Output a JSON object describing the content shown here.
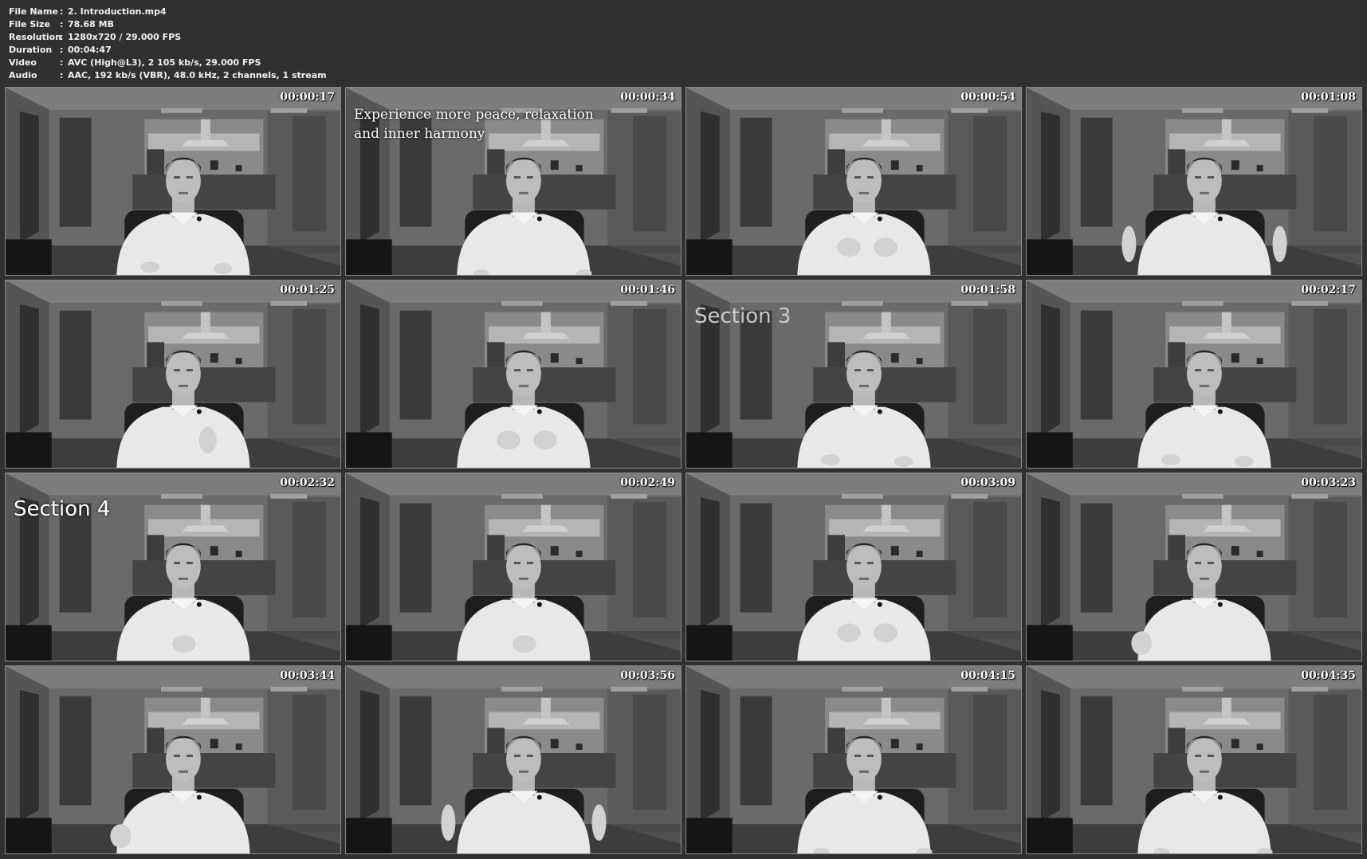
{
  "file_info": [
    {
      "label": "File Name",
      "value": "2. Introduction.mp4"
    },
    {
      "label": "File Size",
      "value": "78.68 MB"
    },
    {
      "label": "Resolution",
      "value": "1280x720 / 29.000 FPS"
    },
    {
      "label": "Duration",
      "value": "00:04:47"
    },
    {
      "label": "Video",
      "value": "AVC (High@L3), 2 105 kb/s, 29.000 FPS"
    },
    {
      "label": "Audio",
      "value": "AAC, 192 kb/s (VBR), 48.0 kHz, 2 channels, 1 stream"
    }
  ],
  "separator": ":",
  "thumbnails": [
    {
      "timestamp": "00:00:17",
      "caption": "",
      "gesture": "hands-low"
    },
    {
      "timestamp": "00:00:34",
      "caption": "Experience more peace, relaxation and inner harmony",
      "gesture": "hands-down"
    },
    {
      "timestamp": "00:00:54",
      "caption": "",
      "gesture": "hands-chest"
    },
    {
      "timestamp": "00:01:08",
      "caption": "",
      "gesture": "hands-wide"
    },
    {
      "timestamp": "00:01:25",
      "caption": "",
      "gesture": "hand-right"
    },
    {
      "timestamp": "00:01:46",
      "caption": "",
      "gesture": "hands-chest"
    },
    {
      "timestamp": "00:01:58",
      "caption": "Section 3",
      "gesture": "hands-low"
    },
    {
      "timestamp": "00:02:17",
      "caption": "",
      "gesture": "hands-low"
    },
    {
      "timestamp": "00:02:32",
      "caption": "Section 4",
      "gesture": "hands-center"
    },
    {
      "timestamp": "00:02:49",
      "caption": "",
      "gesture": "hands-center"
    },
    {
      "timestamp": "00:03:09",
      "caption": "",
      "gesture": "hands-chest"
    },
    {
      "timestamp": "00:03:23",
      "caption": "",
      "gesture": "hand-left"
    },
    {
      "timestamp": "00:03:44",
      "caption": "",
      "gesture": "hand-left"
    },
    {
      "timestamp": "00:03:56",
      "caption": "",
      "gesture": "hands-wide"
    },
    {
      "timestamp": "00:04:15",
      "caption": "",
      "gesture": "hands-down"
    },
    {
      "timestamp": "00:04:35",
      "caption": "",
      "gesture": "hands-down"
    }
  ],
  "colors": {
    "background": "#303030",
    "info_text": "#f2f2f2",
    "timestamp_text": "#ffffff"
  }
}
